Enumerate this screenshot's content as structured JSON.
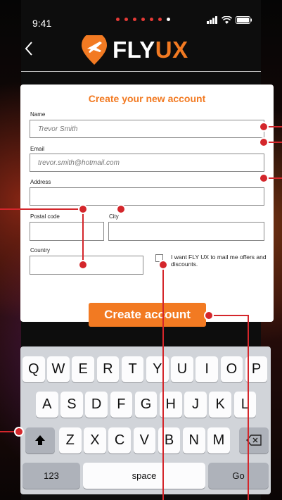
{
  "status_bar": {
    "time": "9:41"
  },
  "header": {
    "logo_fly": "FLY",
    "logo_ux": "UX"
  },
  "form": {
    "title": "Create your new account",
    "fields": {
      "name": {
        "label": "Name",
        "placeholder": "Trevor Smith"
      },
      "email": {
        "label": "Email",
        "placeholder": "trevor.smith@hotmail.com"
      },
      "address": {
        "label": "Address",
        "placeholder": ""
      },
      "postal_code": {
        "label": "Postal code",
        "placeholder": ""
      },
      "city": {
        "label": "City",
        "placeholder": ""
      },
      "country": {
        "label": "Country",
        "placeholder": ""
      }
    },
    "optin_label": "I want FLY UX to mail me offers and discounts.",
    "submit_label": "Create account"
  },
  "keyboard": {
    "row1": [
      "Q",
      "W",
      "E",
      "R",
      "T",
      "Y",
      "U",
      "I",
      "O",
      "P"
    ],
    "row2": [
      "A",
      "S",
      "D",
      "F",
      "G",
      "H",
      "J",
      "K",
      "L"
    ],
    "row3": [
      "Z",
      "X",
      "C",
      "V",
      "B",
      "N",
      "M"
    ],
    "numbers_label": "123",
    "space_label": "space",
    "go_label": "Go"
  },
  "colors": {
    "accent": "#f27a22",
    "annotation": "#d4262b"
  }
}
